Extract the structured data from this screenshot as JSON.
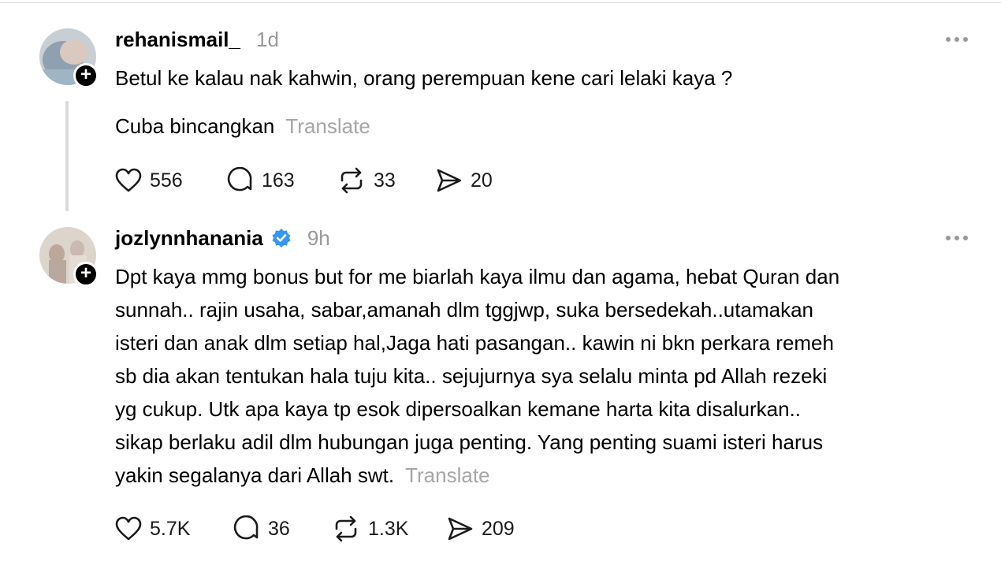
{
  "posts": [
    {
      "username": "rehanismail_",
      "time": "1d",
      "lines": [
        "Betul ke kalau nak kahwin, orang perempuan kene cari lelaki kaya ?"
      ],
      "second_line": "Cuba bincangkan",
      "translate": "Translate",
      "follow": "+",
      "actions": {
        "likes": "556",
        "replies": "163",
        "reposts": "33",
        "shares": "20"
      }
    },
    {
      "username": "jozlynnhanania",
      "time": "9h",
      "lines": [
        "Dpt kaya mmg bonus but for me biarlah kaya ilmu dan agama, hebat Quran dan",
        "sunnah.. rajin usaha, sabar,amanah dlm tggjwp, suka bersedekah..utamakan",
        "isteri dan anak dlm setiap hal,Jaga hati pasangan.. kawin ni bkn perkara remeh",
        "sb dia akan tentukan hala tuju kita.. sejujurnya sya selalu minta pd Allah rezeki",
        "yg cukup. Utk apa kaya tp esok dipersoalkan kemane harta kita disalurkan..",
        "sikap berlaku adil dlm hubungan juga penting. Yang penting suami isteri harus",
        "yakin segalanya dari Allah swt."
      ],
      "translate": "Translate",
      "follow": "+",
      "actions": {
        "likes": "5.7K",
        "replies": "36",
        "reposts": "1.3K",
        "shares": "209"
      }
    }
  ],
  "icons": {
    "verified": "verified-badge-icon",
    "like": "heart-icon",
    "reply": "comment-icon",
    "repost": "repost-icon",
    "share": "send-icon",
    "more": "more-icon"
  },
  "colors": {
    "verified": "#3897f0",
    "muted": "#999999",
    "thread_line": "#d9d9d9"
  }
}
